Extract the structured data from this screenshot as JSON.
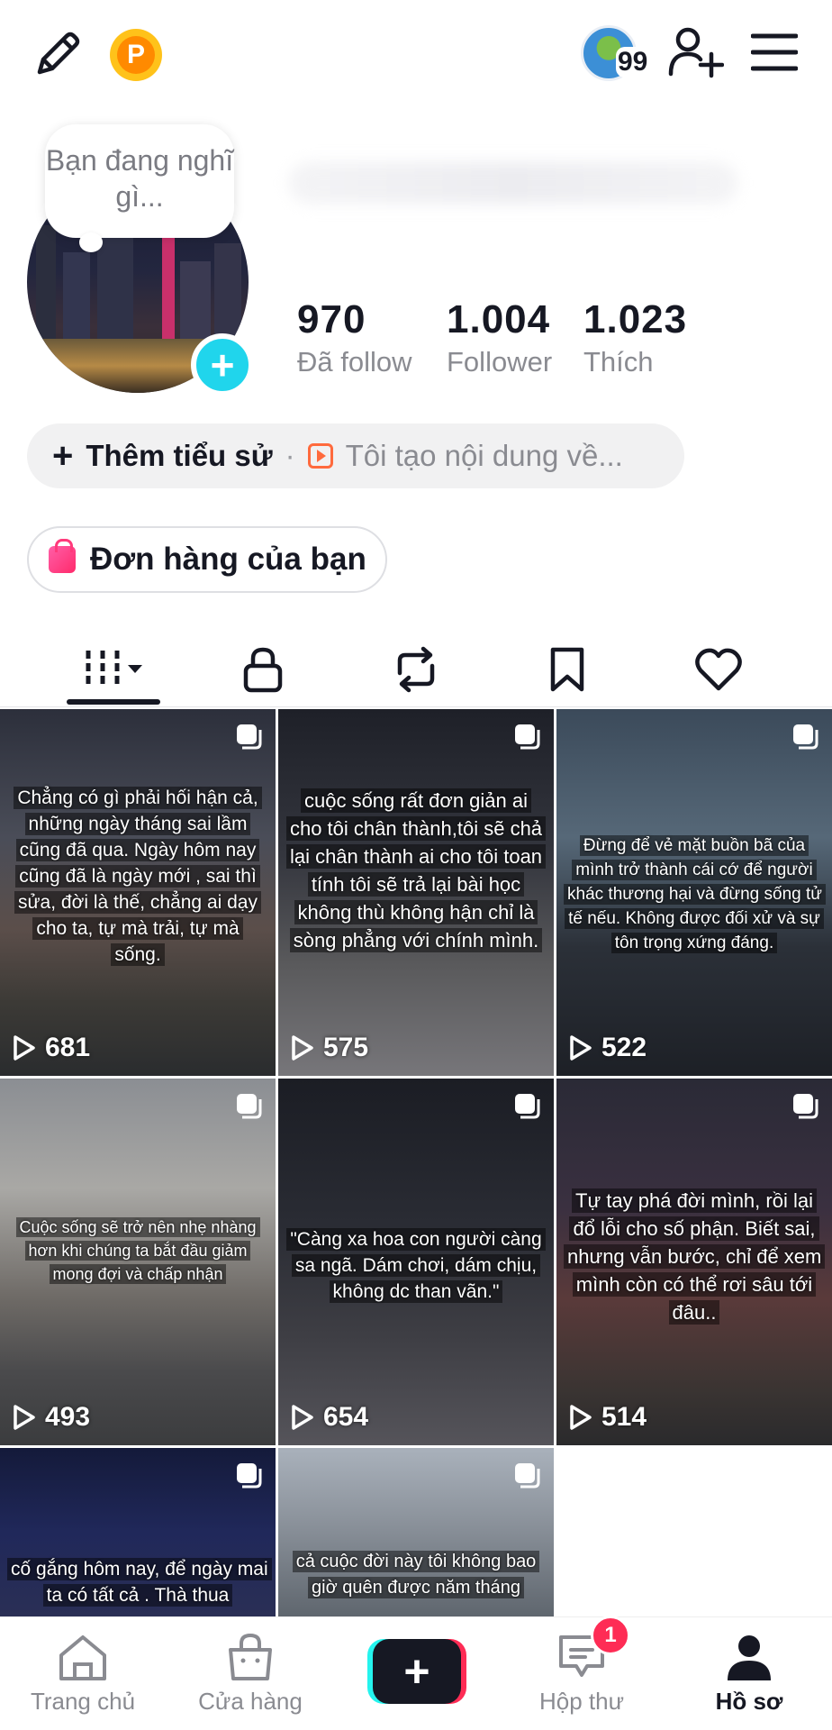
{
  "header": {
    "coin_letter": "P",
    "friends_badge_count": "99"
  },
  "profile": {
    "bubble_text": "Bạn đang nghĩ gì...",
    "stats": [
      {
        "value": "970",
        "label": "Đã follow"
      },
      {
        "value": "1.004",
        "label": "Follower"
      },
      {
        "value": "1.023",
        "label": "Thích"
      }
    ],
    "bio": {
      "add_label": "Thêm tiểu sử",
      "separator": "·",
      "creator_desc": "Tôi tạo nội dung về..."
    },
    "orders_label": "Đơn hàng của bạn"
  },
  "tabs": [
    {
      "icon": "grid-icon",
      "active": true
    },
    {
      "icon": "lock-icon"
    },
    {
      "icon": "repost-icon"
    },
    {
      "icon": "bookmark-icon"
    },
    {
      "icon": "heart-icon"
    }
  ],
  "videos": [
    {
      "views": "681",
      "caption": "Chẳng có gì phải hối hận cả, những ngày tháng sai lầm cũng đã qua. Ngày hôm nay cũng đã là ngày mới , sai thì sửa, đời là thế, chẳng ai dạy cho ta, tự mà trải, tự mà sống."
    },
    {
      "views": "575",
      "caption": "cuộc sống rất đơn giản ai cho tôi chân thành,tôi sẽ chả lại chân thành ai cho tôi toan tính tôi sẽ trả lại bài học không thù không hận chỉ là sòng phẳng với chính mình."
    },
    {
      "views": "522",
      "caption": "Đừng để vẻ mặt buồn bã của mình trở thành cái cớ để người khác thương hại và đừng sống tử tế nếu. Không được đối xử và sự tôn trọng xứng đáng."
    },
    {
      "views": "493",
      "caption": "Cuộc sống sẽ trở nên nhẹ nhàng hơn khi chúng ta bắt đầu giảm mong đợi và chấp nhận"
    },
    {
      "views": "654",
      "caption": "\"Càng xa hoa con người càng sa ngã. Dám chơi, dám chịu, không dc than vãn.\""
    },
    {
      "views": "514",
      "caption": "Tự tay phá đời mình, rồi lại đổ lỗi cho số phận. Biết sai, nhưng vẫn bước, chỉ để xem mình còn có thể rơi sâu tới đâu.."
    },
    {
      "views": "",
      "caption": "cố gắng hôm nay, để ngày mai ta có tất cả . Thà thua"
    },
    {
      "views": "",
      "caption": "cả cuộc đời này tôi không bao giờ quên được năm tháng"
    }
  ],
  "bottom_nav": {
    "items": [
      {
        "label": "Trang chủ"
      },
      {
        "label": "Cửa hàng"
      },
      {
        "label": "+"
      },
      {
        "label": "Hộp thư",
        "badge": "1"
      },
      {
        "label": "Hồ sơ"
      }
    ]
  }
}
